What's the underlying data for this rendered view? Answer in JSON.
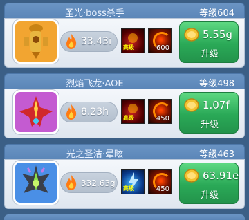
{
  "heroes": [
    {
      "title": "圣光·boss杀手",
      "level": "等级604",
      "dps": "33.43i",
      "skill1_tag": "高级",
      "skill2_count": "600",
      "upgrade_cost": "5.55g",
      "upgrade_label": "升级",
      "avatar_bg": "#f2a531",
      "skill1_icon": "red-demon-icon"
    },
    {
      "title": "烈焰飞龙·AOE",
      "level": "等级498",
      "dps": "8.23h",
      "skill1_tag": "高级",
      "skill2_count": "450",
      "upgrade_cost": "1.07f",
      "upgrade_label": "升级",
      "avatar_bg": "#c45bd1",
      "skill1_icon": "red-demon-icon"
    },
    {
      "title": "光之圣洁·晕眩",
      "level": "等级463",
      "dps": "332.63g",
      "skill1_tag": "高级",
      "skill2_count": "450",
      "upgrade_cost": "63.91e",
      "upgrade_label": "升级",
      "avatar_bg": "#4a8fe6",
      "skill1_icon": "blue-lightning-icon"
    }
  ],
  "colors": {
    "background": "#3b5f86",
    "upgrade_green": "#2aa957",
    "header_blue": "#5b86b8"
  }
}
